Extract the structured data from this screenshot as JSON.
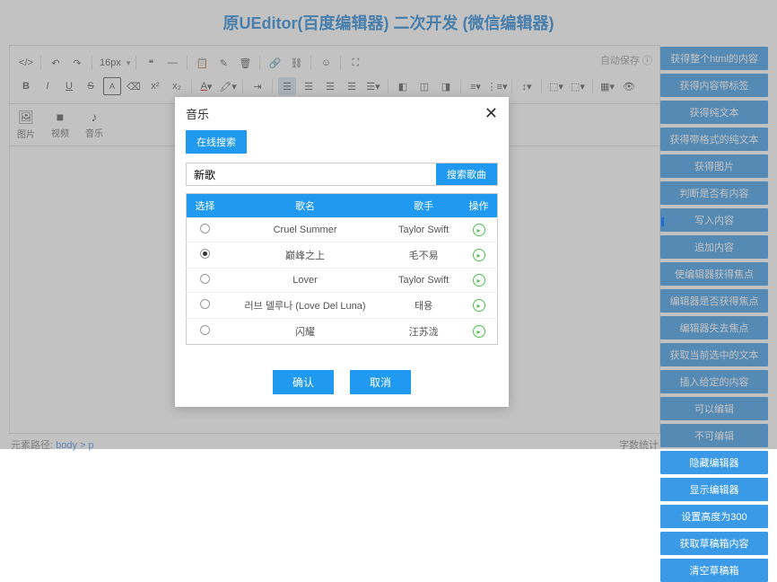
{
  "header": {
    "title": "原UEditor(百度编辑器) 二次开发 (微信编辑器)"
  },
  "toolbar": {
    "fontsize": "16px",
    "autosave": "自动保存 ⓘ"
  },
  "media": {
    "image": "图片",
    "video": "视频",
    "music": "音乐"
  },
  "status": {
    "pathLabel": "元素路径:",
    "path": "body > p",
    "wordcount": "字数统计"
  },
  "side": [
    "获得整个html的内容",
    "获得内容带标签",
    "获得纯文本",
    "获得带格式的纯文本",
    "获得图片",
    "判断是否有内容",
    "写入内容",
    "追加内容",
    "使编辑器获得焦点",
    "编辑器是否获得焦点",
    "编辑器失去焦点",
    "获取当前选中的文本",
    "插入给定的内容",
    "可以编辑",
    "不可编辑",
    "隐藏编辑器",
    "显示编辑器",
    "设置高度为300",
    "获取草稿箱内容",
    "清空草稿箱"
  ],
  "dialog": {
    "title": "音乐",
    "tab": "在线搜索",
    "searchValue": "新歌",
    "searchBtn": "搜索歌曲",
    "cols": {
      "select": "选择",
      "song": "歌名",
      "singer": "歌手",
      "op": "操作"
    },
    "rows": [
      {
        "song": "Cruel Summer",
        "singer": "Taylor Swift",
        "selected": false
      },
      {
        "song": "巅峰之上",
        "singer": "毛不易",
        "selected": true
      },
      {
        "song": "Lover",
        "singer": "Taylor Swift",
        "selected": false
      },
      {
        "song": "러브 델루나 (Love Del Luna)",
        "singer": "태용",
        "selected": false
      },
      {
        "song": "闪耀",
        "singer": "汪苏泷",
        "selected": false
      }
    ],
    "ok": "确认",
    "cancel": "取消"
  }
}
